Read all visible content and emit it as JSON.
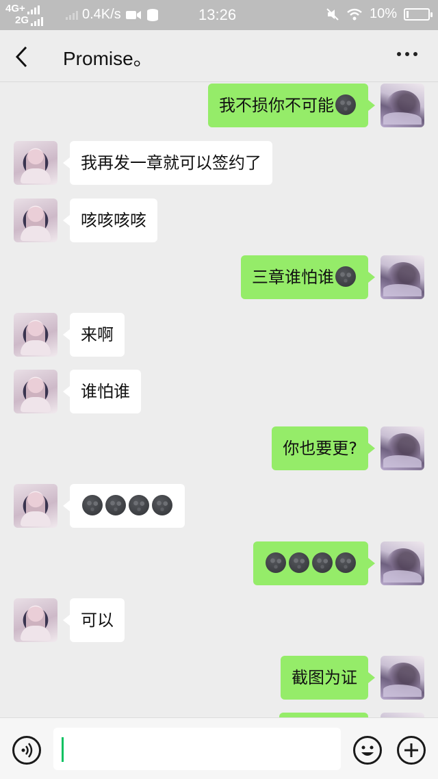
{
  "status_bar": {
    "network_top": "4G+",
    "network_bottom": "2G",
    "speed": "0.4K/s",
    "time": "13:26",
    "battery": "10%",
    "battery_level": 0.1
  },
  "header": {
    "title": "Promise。",
    "back_icon": "chevron-left-icon",
    "more_icon": "more-dots-icon"
  },
  "messages": [
    {
      "side": "right",
      "text": "我不损你不可能",
      "moons": 1
    },
    {
      "side": "left",
      "text": "我再发一章就可以签约了",
      "moons": 0
    },
    {
      "side": "left",
      "text": "咳咳咳咳",
      "moons": 0
    },
    {
      "side": "right",
      "text": "三章谁怕谁",
      "moons": 1
    },
    {
      "side": "left",
      "text": "来啊",
      "moons": 0
    },
    {
      "side": "left",
      "text": "谁怕谁",
      "moons": 0
    },
    {
      "side": "right",
      "text": "你也要更?",
      "moons": 0
    },
    {
      "side": "left",
      "text": "",
      "moons": 4
    },
    {
      "side": "right",
      "text": "",
      "moons": 4
    },
    {
      "side": "left",
      "text": "可以",
      "moons": 0
    },
    {
      "side": "right",
      "text": "截图为证",
      "moons": 0
    }
  ],
  "input_bar": {
    "voice_icon": "voice-icon",
    "emoji_icon": "emoji-icon",
    "plus_icon": "plus-icon",
    "value": ""
  },
  "colors": {
    "background": "#ededed",
    "sent_bubble": "#95ec69",
    "received_bubble": "#ffffff",
    "caret": "#07c160"
  }
}
